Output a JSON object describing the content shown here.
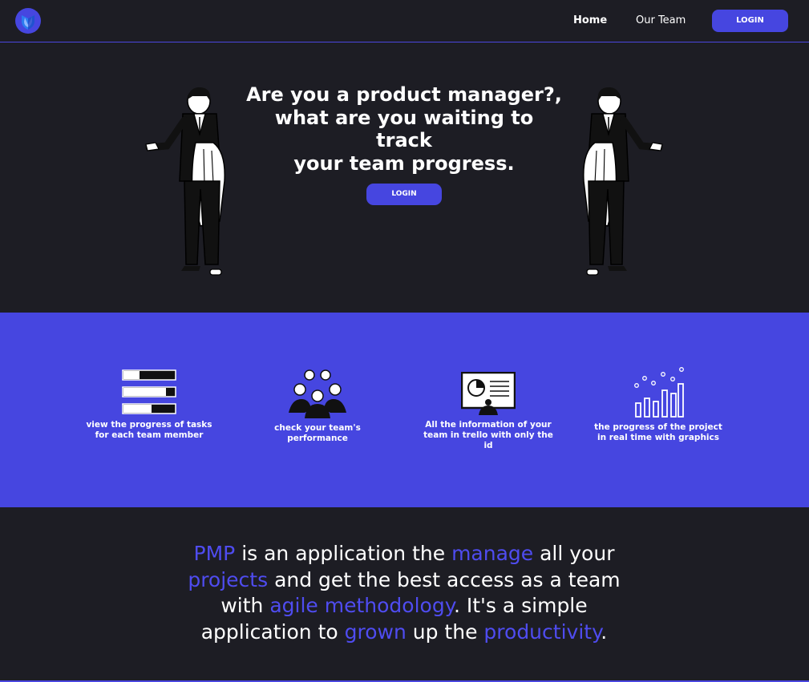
{
  "nav": {
    "home": "Home",
    "our_team": "Our Team",
    "login": "LOGIN"
  },
  "hero": {
    "title_line1": "Are you a product manager?,",
    "title_line2": "what are you waiting to track",
    "title_line3": "your team progress.",
    "button": "LOGIN"
  },
  "features": [
    {
      "icon": "progress-bars-icon",
      "label": "view the progress of tasks for each team member"
    },
    {
      "icon": "team-group-icon",
      "label": "check your team's performance"
    },
    {
      "icon": "presentation-board-icon",
      "label": "All the information of your team in trello with only the id"
    },
    {
      "icon": "bar-chart-icon",
      "label": "the progress of the project in real time with graphics"
    }
  ],
  "about": {
    "s1": "PMP",
    "s2": " is an application the ",
    "s3": "manage",
    "s4": " all your ",
    "s5": "projects",
    "s6": " and get the best access as a team with ",
    "s7": "agile methodology",
    "s8": ". It's a simple application to ",
    "s9": "grown",
    "s10": " up the ",
    "s11": "productivity",
    "s12": "."
  },
  "colors": {
    "accent": "#4646e0",
    "background": "#1d1d24",
    "highlight": "#4f4cf0"
  }
}
